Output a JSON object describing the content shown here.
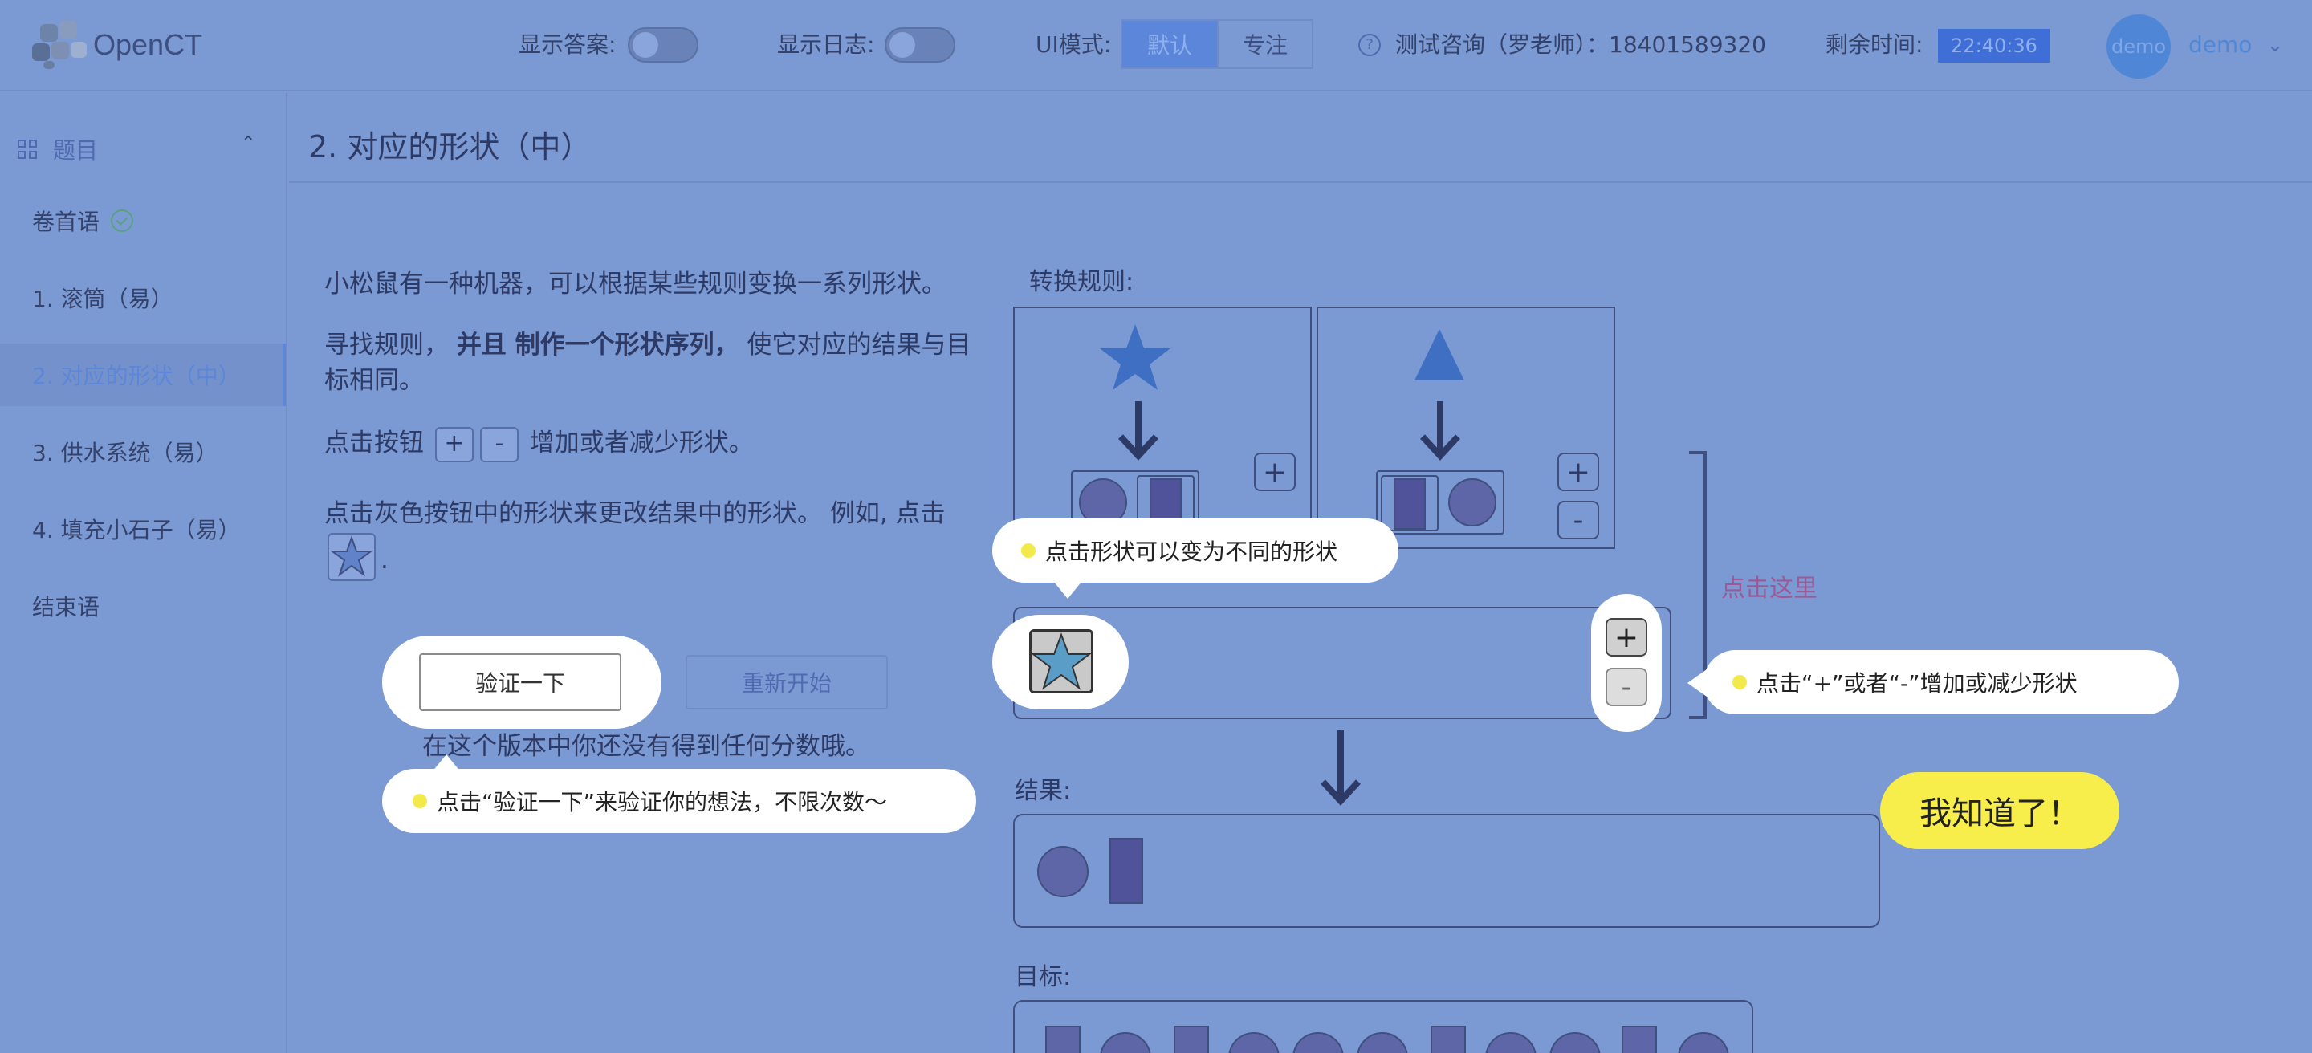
{
  "header": {
    "logo_text": "OpenCT",
    "show_answer_label": "显示答案:",
    "show_log_label": "显示日志:",
    "ui_mode_label": "UI模式:",
    "ui_modes": [
      "默认",
      "专注"
    ],
    "ui_mode_selected": "默认",
    "consult_text": "测试咨询（罗老师）：18401589320",
    "time_left_label": "剩余时间:",
    "time_left": "22:40:36",
    "avatar_text": "demo",
    "username": "demo"
  },
  "sidebar": {
    "section_label": "题目",
    "items": [
      {
        "label": "卷首语"
      },
      {
        "label": "1. 滚筒（易）"
      },
      {
        "label": "2. 对应的形状（中）"
      },
      {
        "label": "3. 供水系统（易）"
      },
      {
        "label": "4. 填充小石子（易）"
      },
      {
        "label": "结束语"
      }
    ]
  },
  "main": {
    "title": "2. 对应的形状（中）",
    "intro": "小松鼠有一种机器，可以根据某些规则变换一系列形状。",
    "task_a": "寻找规则，",
    "task_b": "并且 制作一个形状序列，",
    "task_c": "使它对应的结果与目标相同。",
    "btn_hint_a": "点击按钮",
    "btn_hint_b": "增加或者减少形状。",
    "shape_hint": "点击灰色按钮中的形状来更改结果中的形状。 例如, 点击",
    "shape_hint_end": ".",
    "plus": "+",
    "minus": "-",
    "rules_label": "转换规则:",
    "result_label": "结果:",
    "target_label": "目标:",
    "verify_button": "验证一下",
    "restart_button": "重新开始",
    "score_note": "在这个版本中你还没有得到任何分数哦。",
    "click_here": "点击这里"
  },
  "tips": {
    "shape_tip": "点击形状可以变为不同的形状",
    "plusminus_tip": "点击“+”或者“-”增加或减少形状",
    "verify_tip": "点击“验证一下”来验证你的想法，不限次数～",
    "ok_button": "我知道了！"
  },
  "target_sequence": [
    "rect",
    "circle",
    "rect",
    "circle",
    "circle",
    "circle",
    "rect",
    "circle",
    "circle",
    "rect",
    "circle"
  ]
}
